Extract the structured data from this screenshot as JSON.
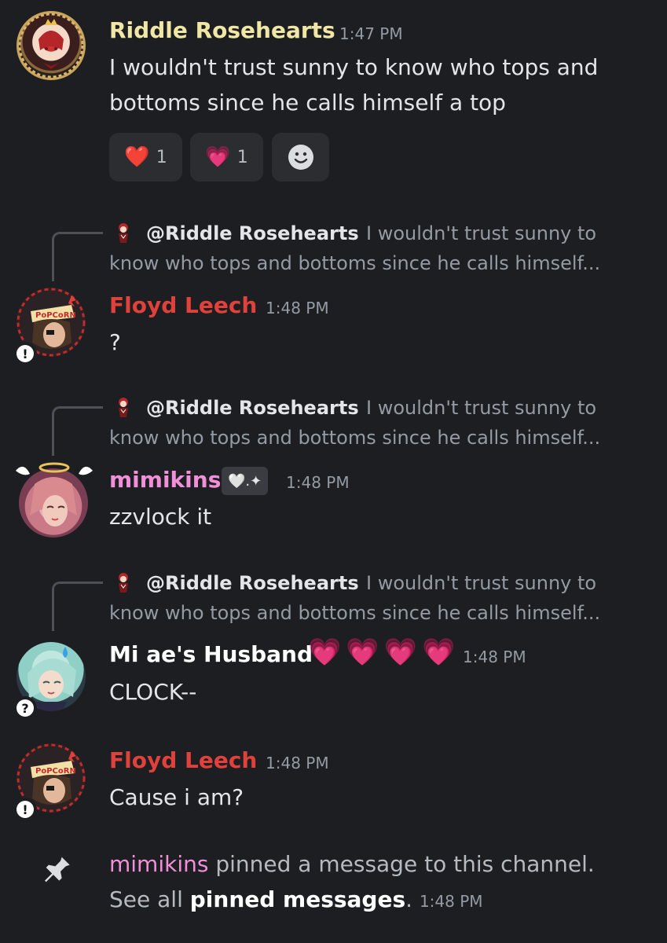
{
  "messages": [
    {
      "author": "Riddle Rosehearts",
      "time": "1:47 PM",
      "lines": [
        "I wouldn't trust sunny to know who tops and",
        "bottoms since he calls himself a top"
      ],
      "reactions": [
        {
          "emoji": "❤️",
          "icon": "red-heart-icon",
          "count": "1"
        },
        {
          "emoji": "💗",
          "icon": "pink-heart-icon",
          "count": "1"
        }
      ]
    },
    {
      "reply": {
        "author": "@Riddle Rosehearts",
        "preview_line1": "I wouldn't trust sunny to",
        "preview_line2": "know who tops and bottoms since he calls himself..."
      },
      "author": "Floyd Leech",
      "time": "1:48 PM",
      "text": "?",
      "badge": "!"
    },
    {
      "reply": {
        "author": "@Riddle Rosehearts",
        "preview_line1": "I wouldn't trust sunny to",
        "preview_line2": "know who tops and bottoms since he calls himself..."
      },
      "author": "mimikins",
      "tag": "🤍.✦",
      "time": "1:48 PM",
      "text": "zzvlock it"
    },
    {
      "reply": {
        "author": "@Riddle Rosehearts",
        "preview_line1": "I wouldn't trust sunny to",
        "preview_line2": "know who tops and bottoms since he calls himself..."
      },
      "author": "Mi ae's Husband",
      "author_emoji": "💗💗💗💗",
      "time": "1:48 PM",
      "text": "CLOCK--",
      "badge": "?"
    },
    {
      "author": "Floyd Leech",
      "time": "1:48 PM",
      "text": "Cause i am?",
      "badge": "!"
    }
  ],
  "system": {
    "user": "mimikins",
    "action": "pinned a message to this channel.",
    "see_all": "See all",
    "link": "pinned messages",
    "period": ".",
    "time": "1:48 PM"
  },
  "colors": {
    "riddle": "#f0e6a6",
    "floyd": "#e0413b",
    "mimikins": "#f18fd8",
    "husband": "#ffffff",
    "background": "#1d1e22"
  }
}
